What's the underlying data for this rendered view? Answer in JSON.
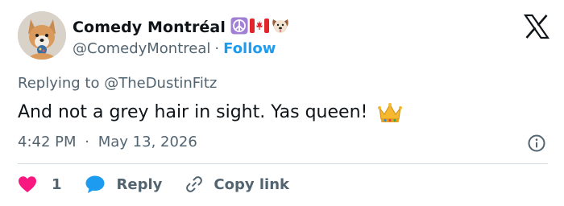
{
  "author": {
    "display_name": "Comedy Montréal",
    "handle": "@ComedyMontreal",
    "separator": "·",
    "follow_label": "Follow",
    "name_emojis": [
      "peace-symbol-icon",
      "canada-flag-icon",
      "dog-face-icon"
    ]
  },
  "tweet": {
    "replying_prefix": "Replying to",
    "replying_to": "@TheDustinFitz",
    "text": "And not a grey hair in sight. Yas queen!",
    "text_emoji": "crown-icon",
    "time": "4:42 PM",
    "separator": "·",
    "date": "May 13, 2026"
  },
  "actions": {
    "like_count": "1",
    "reply_label": "Reply",
    "copy_label": "Copy link"
  },
  "colors": {
    "text_primary": "#0f1419",
    "text_secondary": "#536471",
    "link_blue": "#1d9bf0",
    "heart_pink": "#f91880",
    "divider": "#cfd9de"
  }
}
